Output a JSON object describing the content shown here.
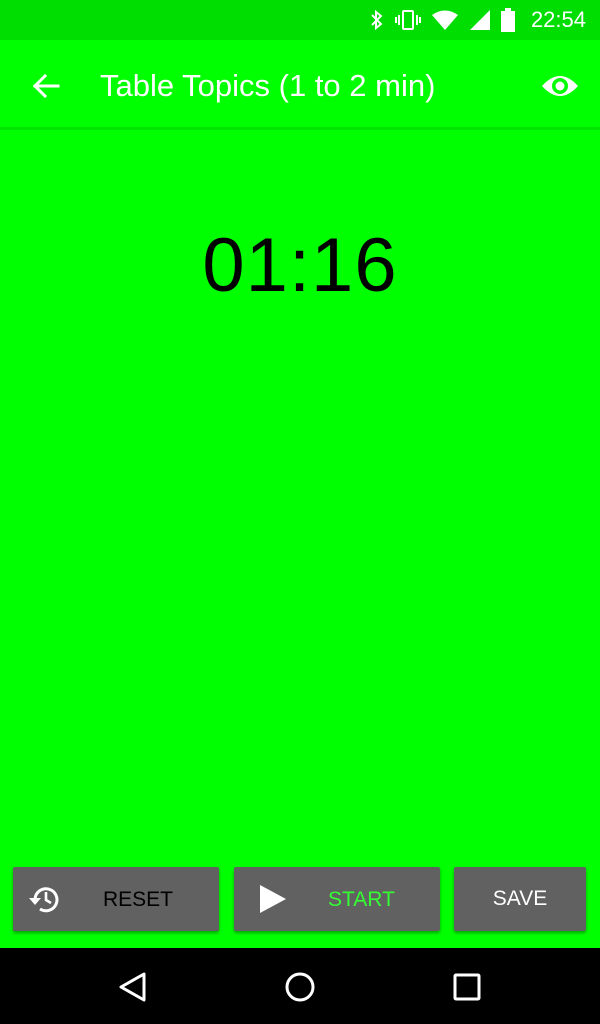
{
  "status_bar": {
    "time": "22:54",
    "icons": [
      "bluetooth-icon",
      "vibrate-icon",
      "wifi-icon",
      "signal-icon",
      "battery-icon"
    ]
  },
  "app_bar": {
    "title": "Table Topics (1 to 2 min)",
    "icons": [
      "back-arrow-icon",
      "eye-icon"
    ]
  },
  "timer": {
    "display": "01:16"
  },
  "buttons": {
    "reset_label": "RESET",
    "start_label": "START",
    "save_label": "SAVE"
  },
  "nav_bar": {
    "icons": [
      "nav-back-icon",
      "nav-home-icon",
      "nav-recents-icon"
    ]
  },
  "colors": {
    "background": "#00ff00",
    "status_bar": "#00dd00",
    "button": "#616161",
    "start_label": "#33ff33"
  }
}
